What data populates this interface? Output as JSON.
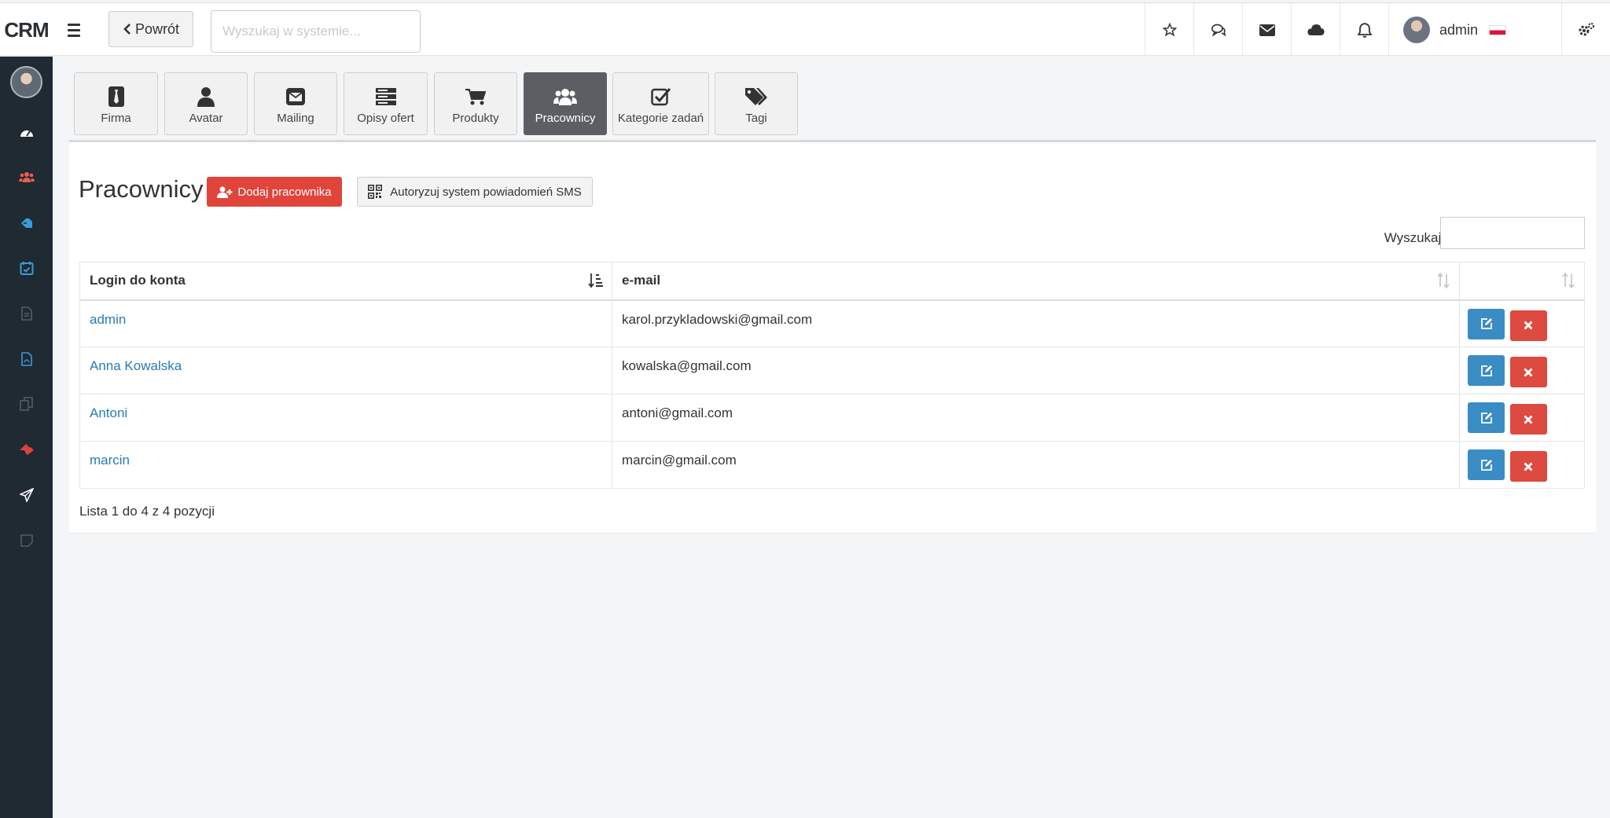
{
  "app": {
    "brand": "CRM"
  },
  "topbar": {
    "back_label": "Powrót",
    "search_placeholder": "Wyszukaj w systemie...",
    "user_name": "admin"
  },
  "tabs": [
    {
      "label": "Firma",
      "icon": "tie-icon"
    },
    {
      "label": "Avatar",
      "icon": "user-icon"
    },
    {
      "label": "Mailing",
      "icon": "envelope-square-icon"
    },
    {
      "label": "Opisy ofert",
      "icon": "server-icon"
    },
    {
      "label": "Produkty",
      "icon": "cart-icon"
    },
    {
      "label": "Pracownicy",
      "icon": "users-icon",
      "active": true
    },
    {
      "label": "Kategorie zadań",
      "icon": "check-square-icon"
    },
    {
      "label": "Tagi",
      "icon": "tags-icon"
    }
  ],
  "page": {
    "title": "Pracownicy",
    "add_label": "Dodaj pracownika",
    "sms_label": "Autoryzuj system powiadomień SMS",
    "search_label": "Wyszukaj:"
  },
  "table": {
    "columns": [
      "Login do konta",
      "e-mail",
      ""
    ],
    "rows": [
      {
        "login": "admin",
        "email": "karol.przykladowski@gmail.com"
      },
      {
        "login": "Anna Kowalska",
        "email": "kowalska@gmail.com"
      },
      {
        "login": "Antoni",
        "email": "antoni@gmail.com"
      },
      {
        "login": "marcin",
        "email": "marcin@gmail.com"
      }
    ],
    "info": "Lista 1 do 4 z 4 pozycji"
  },
  "colors": {
    "accent_red": "#e0443a",
    "accent_blue": "#3a8cc4",
    "sidebar": "#1f2a33",
    "link": "#2a7bb5"
  }
}
